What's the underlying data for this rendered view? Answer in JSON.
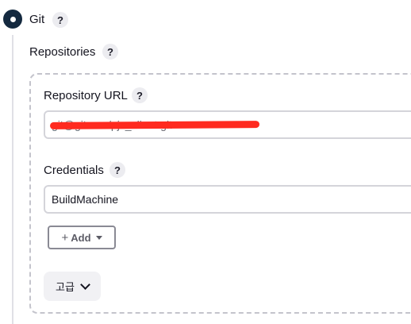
{
  "scm": {
    "option_label": "Git",
    "selected": true
  },
  "repositories": {
    "label": "Repositories",
    "repository_url": {
      "label": "Repository URL",
      "value": "git@git...:.../pjx_client.git",
      "redacted": true
    },
    "credentials": {
      "label": "Credentials",
      "value": "BuildMachine"
    },
    "add_button": {
      "plus": "+",
      "label": "Add"
    },
    "advanced_button": {
      "label": "고급"
    }
  },
  "help_symbol": "?",
  "colors": {
    "radio": "#14293f",
    "redaction": "#ff2a1f",
    "dashed_border": "#c4c4cc"
  }
}
